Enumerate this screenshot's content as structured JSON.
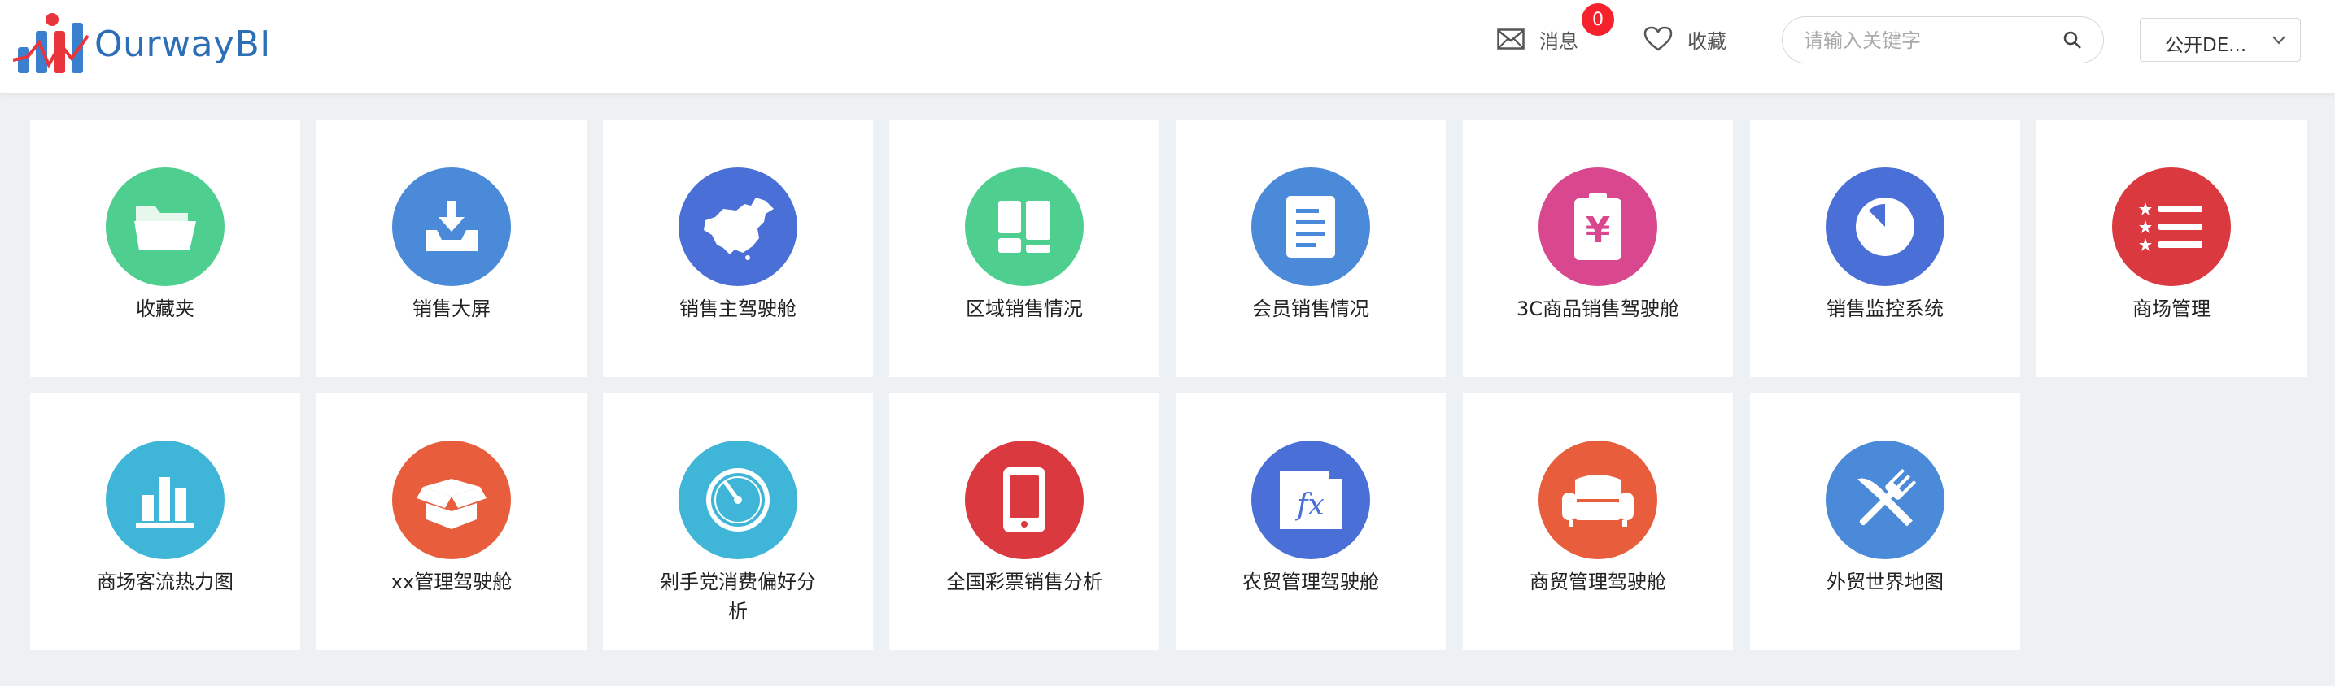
{
  "header": {
    "logo_text": "OurwayBI",
    "messages_label": "消息",
    "messages_count": "0",
    "favorites_label": "收藏",
    "search_placeholder": "请输入关键字",
    "space_select_value": "公开DE..."
  },
  "cards": [
    {
      "label": "收藏夹",
      "icon": "folder-icon",
      "color": "#4ecf8f"
    },
    {
      "label": "销售大屏",
      "icon": "inbox-download-icon",
      "color": "#4a8ad8"
    },
    {
      "label": "销售主驾驶舱",
      "icon": "china-map-icon",
      "color": "#4a6fd6"
    },
    {
      "label": "区域销售情况",
      "icon": "dashboard-layout-icon",
      "color": "#4ecf8f"
    },
    {
      "label": "会员销售情况",
      "icon": "document-icon",
      "color": "#4a8ad8"
    },
    {
      "label": "3C商品销售驾驶舱",
      "icon": "yuan-clipboard-icon",
      "color": "#d9478f"
    },
    {
      "label": "销售监控系统",
      "icon": "pie-chart-icon",
      "color": "#4a6fd6"
    },
    {
      "label": "商场管理",
      "icon": "list-icon",
      "color": "#d9393f"
    },
    {
      "label": "商场客流热力图",
      "icon": "bar-chart-icon",
      "color": "#3fb6d8"
    },
    {
      "label": "xx管理驾驶舱",
      "icon": "open-box-icon",
      "color": "#e85d3c"
    },
    {
      "label": "剁手党消费偏好分析",
      "icon": "gauge-icon",
      "color": "#3fb6d8"
    },
    {
      "label": "全国彩票销售分析",
      "icon": "tablet-icon",
      "color": "#d9393f"
    },
    {
      "label": "农贸管理驾驶舱",
      "icon": "function-file-icon",
      "color": "#4a6fd6"
    },
    {
      "label": "商贸管理驾驶舱",
      "icon": "sofa-icon",
      "color": "#e85d3c"
    },
    {
      "label": "外贸世界地图",
      "icon": "fork-knife-icon",
      "color": "#4a8ad8"
    }
  ]
}
